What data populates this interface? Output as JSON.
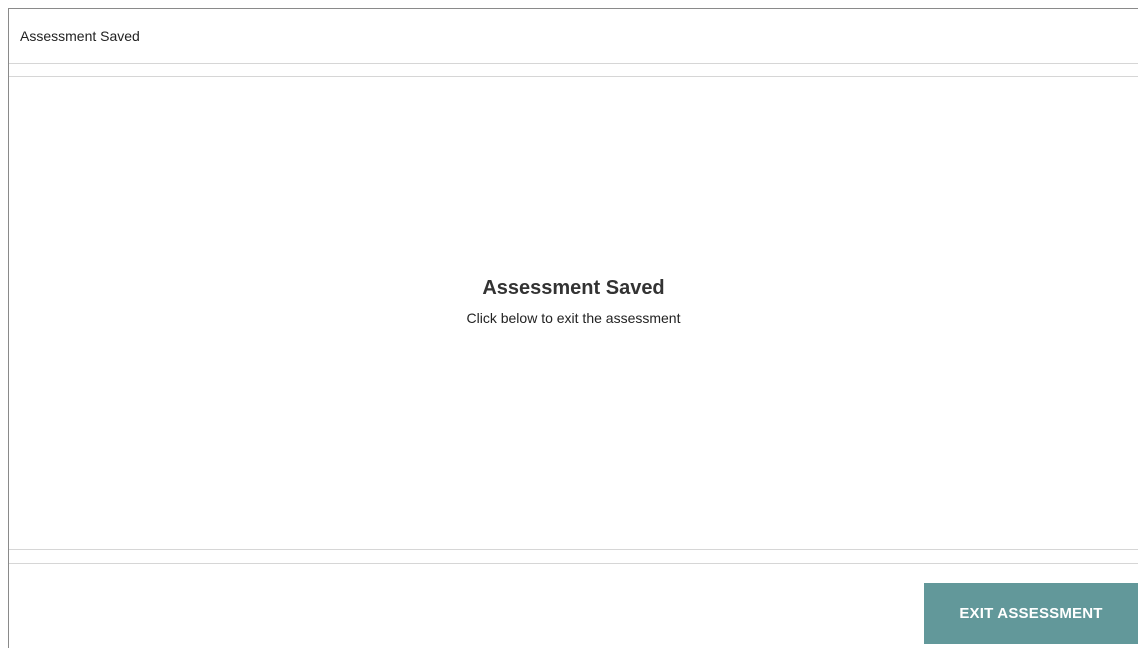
{
  "header": {
    "title": "Assessment Saved"
  },
  "main": {
    "heading": "Assessment Saved",
    "subtext": "Click below to exit the assessment"
  },
  "footer": {
    "exit_button_label": "EXIT ASSESSMENT"
  },
  "colors": {
    "button_background": "#62989a",
    "button_text": "#ffffff",
    "divider": "#d6d6d6",
    "frame_border": "#8a8a8a"
  }
}
